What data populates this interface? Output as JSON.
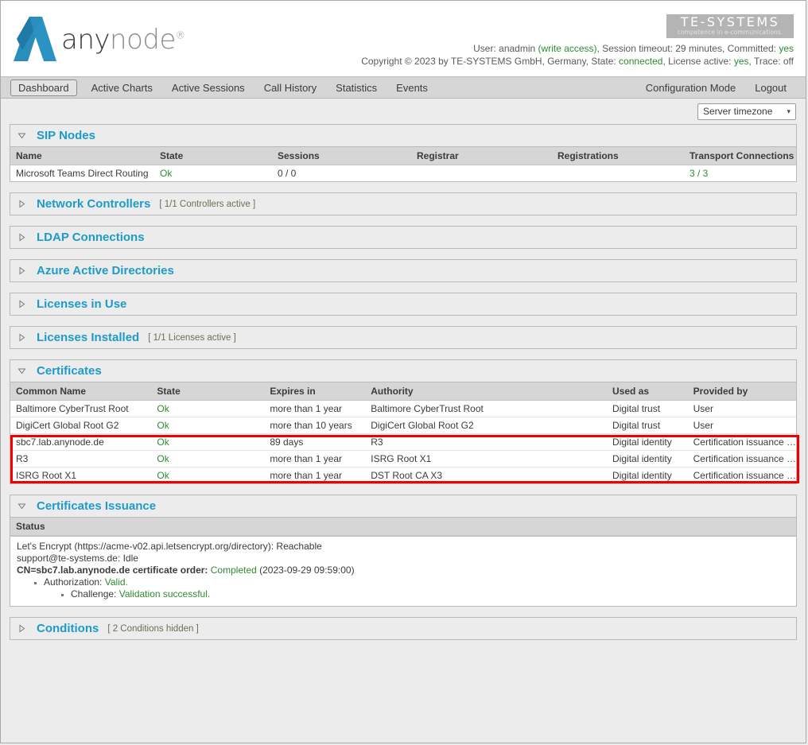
{
  "header": {
    "logo_any": "any",
    "logo_node": "node",
    "logo_reg": "®",
    "brand_main": "TE-SYSTEMS",
    "brand_sub": "competence in e-communications.",
    "line1_pre": "User: ",
    "user": "anadmin",
    "write_access": "(write access)",
    "line1_mid": ", Session timeout: 29 minutes, Committed: ",
    "committed": "yes",
    "line2_pre": "Copyright © 2023 by TE-SYSTEMS GmbH, Germany, State: ",
    "state": "connected",
    "line2_mid": ", License active: ",
    "license_active": "yes",
    "line2_end": ", Trace: off"
  },
  "nav": {
    "left": [
      {
        "label": "Dashboard",
        "active": true
      },
      {
        "label": "Active Charts",
        "active": false
      },
      {
        "label": "Active Sessions",
        "active": false
      },
      {
        "label": "Call History",
        "active": false
      },
      {
        "label": "Statistics",
        "active": false
      },
      {
        "label": "Events",
        "active": false
      }
    ],
    "right": [
      {
        "label": "Configuration Mode"
      },
      {
        "label": "Logout"
      }
    ]
  },
  "toolbar": {
    "timezone_value": "Server timezone",
    "caret": "▾"
  },
  "sections": {
    "sip_nodes": {
      "title": "SIP Nodes",
      "expanded": true,
      "columns": [
        "Name",
        "State",
        "Sessions",
        "Registrar",
        "Registrations",
        "Transport Connections"
      ],
      "rows": [
        {
          "name": "Microsoft Teams Direct Routing",
          "state": "Ok",
          "sessions": "0 / 0",
          "registrar": "",
          "registrations": "",
          "transport": "3 / 3"
        }
      ]
    },
    "network_controllers": {
      "title": "Network Controllers",
      "note": "[ 1/1 Controllers active ]",
      "expanded": false
    },
    "ldap_connections": {
      "title": "LDAP Connections",
      "note": "",
      "expanded": false
    },
    "azure_ad": {
      "title": "Azure Active Directories",
      "note": "",
      "expanded": false
    },
    "licenses_in_use": {
      "title": "Licenses in Use",
      "note": "",
      "expanded": false
    },
    "licenses_installed": {
      "title": "Licenses Installed",
      "note": "[ 1/1 Licenses active ]",
      "expanded": false
    },
    "certificates": {
      "title": "Certificates",
      "expanded": true,
      "columns": [
        "Common Name",
        "State",
        "Expires in",
        "Authority",
        "Used as",
        "Provided by"
      ],
      "rows": [
        {
          "common_name": "Baltimore CyberTrust Root",
          "state": "Ok",
          "expires": "more than 1 year",
          "authority": "Baltimore CyberTrust Root",
          "used_as": "Digital trust",
          "provided_by": "User",
          "highlighted": false
        },
        {
          "common_name": "DigiCert Global Root G2",
          "state": "Ok",
          "expires": "more than 10 years",
          "authority": "DigiCert Global Root G2",
          "used_as": "Digital trust",
          "provided_by": "User",
          "highlighted": false
        },
        {
          "common_name": "sbc7.lab.anynode.de",
          "state": "Ok",
          "expires": "89 days",
          "authority": "R3",
          "used_as": "Digital identity",
          "provided_by": "Certification issuance …",
          "highlighted": true
        },
        {
          "common_name": "R3",
          "state": "Ok",
          "expires": "more than 1 year",
          "authority": "ISRG Root X1",
          "used_as": "Digital identity",
          "provided_by": "Certification issuance …",
          "highlighted": true
        },
        {
          "common_name": "ISRG Root X1",
          "state": "Ok",
          "expires": "more than 1 year",
          "authority": "DST Root CA X3",
          "used_as": "Digital identity",
          "provided_by": "Certification issuance …",
          "highlighted": true
        }
      ]
    },
    "certificates_issuance": {
      "title": "Certificates Issuance",
      "expanded": true,
      "status_header": "Status",
      "line1": "Let's Encrypt (https://acme-v02.api.letsencrypt.org/directory): Reachable",
      "line2": "support@te-systems.de: Idle",
      "line3_bold": "CN=sbc7.lab.anynode.de certificate order:",
      "line3_status": "Completed",
      "line3_date": "(2023-09-29 09:59:00)",
      "auth_label": "Authorization:",
      "auth_value": "Valid.",
      "challenge_label": "Challenge:",
      "challenge_value": "Validation successful."
    },
    "conditions": {
      "title": "Conditions",
      "note": "[ 2 Conditions hidden ]",
      "expanded": false
    }
  },
  "colors": {
    "accent": "#1d9bc9",
    "ok_green": "#2e8b2e",
    "highlight_red": "#f20000",
    "note_olive": "#6e6e56"
  }
}
